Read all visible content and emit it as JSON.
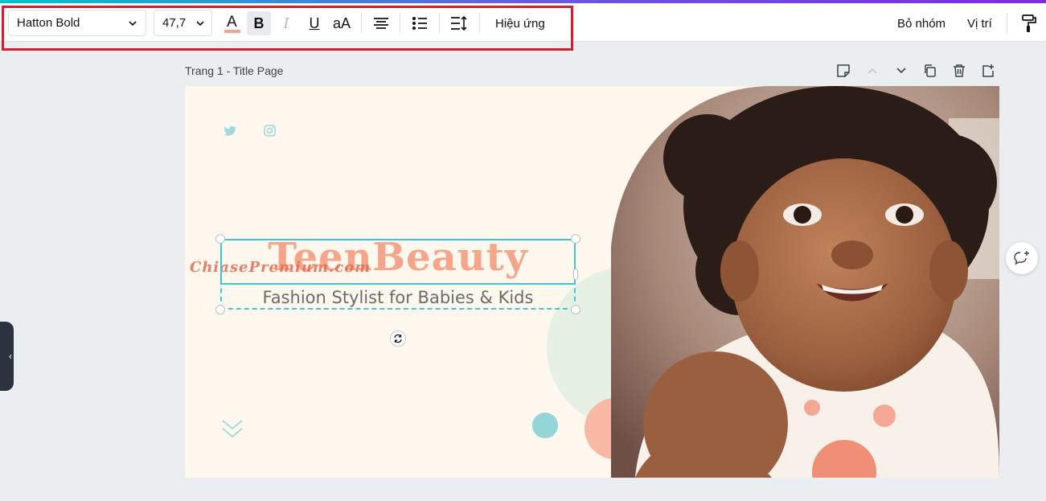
{
  "toolbar": {
    "font_name": "Hatton Bold",
    "font_size": "47,7",
    "text_color_letter": "A",
    "bold_letter": "B",
    "italic_letter": "I",
    "underline_letter": "U",
    "case_label": "aA",
    "effects_label": "Hiệu ứng",
    "ungroup_label": "Bỏ nhóm",
    "position_label": "Vị trí"
  },
  "page": {
    "label": "Trang 1 - Title Page"
  },
  "design": {
    "title": "TeenBeauty",
    "subtitle": "Fashion Stylist for Babies & Kids",
    "watermark": "ChiasePremium.com"
  },
  "colors": {
    "accent_teal": "#3cc7d1",
    "highlight_red": "#d4202e",
    "title_coral": "#f5a58a",
    "canvas_bg": "#fdf7ee"
  },
  "icons": [
    "chevron-down-icon",
    "text-color-icon",
    "align-center-icon",
    "list-icon",
    "spacing-icon",
    "paint-roller-icon",
    "note-icon",
    "chevron-up-icon",
    "copy-icon",
    "trash-icon",
    "add-page-icon",
    "twitter-icon",
    "instagram-icon",
    "rotate-icon",
    "comment-add-icon",
    "double-chevron-icon"
  ]
}
